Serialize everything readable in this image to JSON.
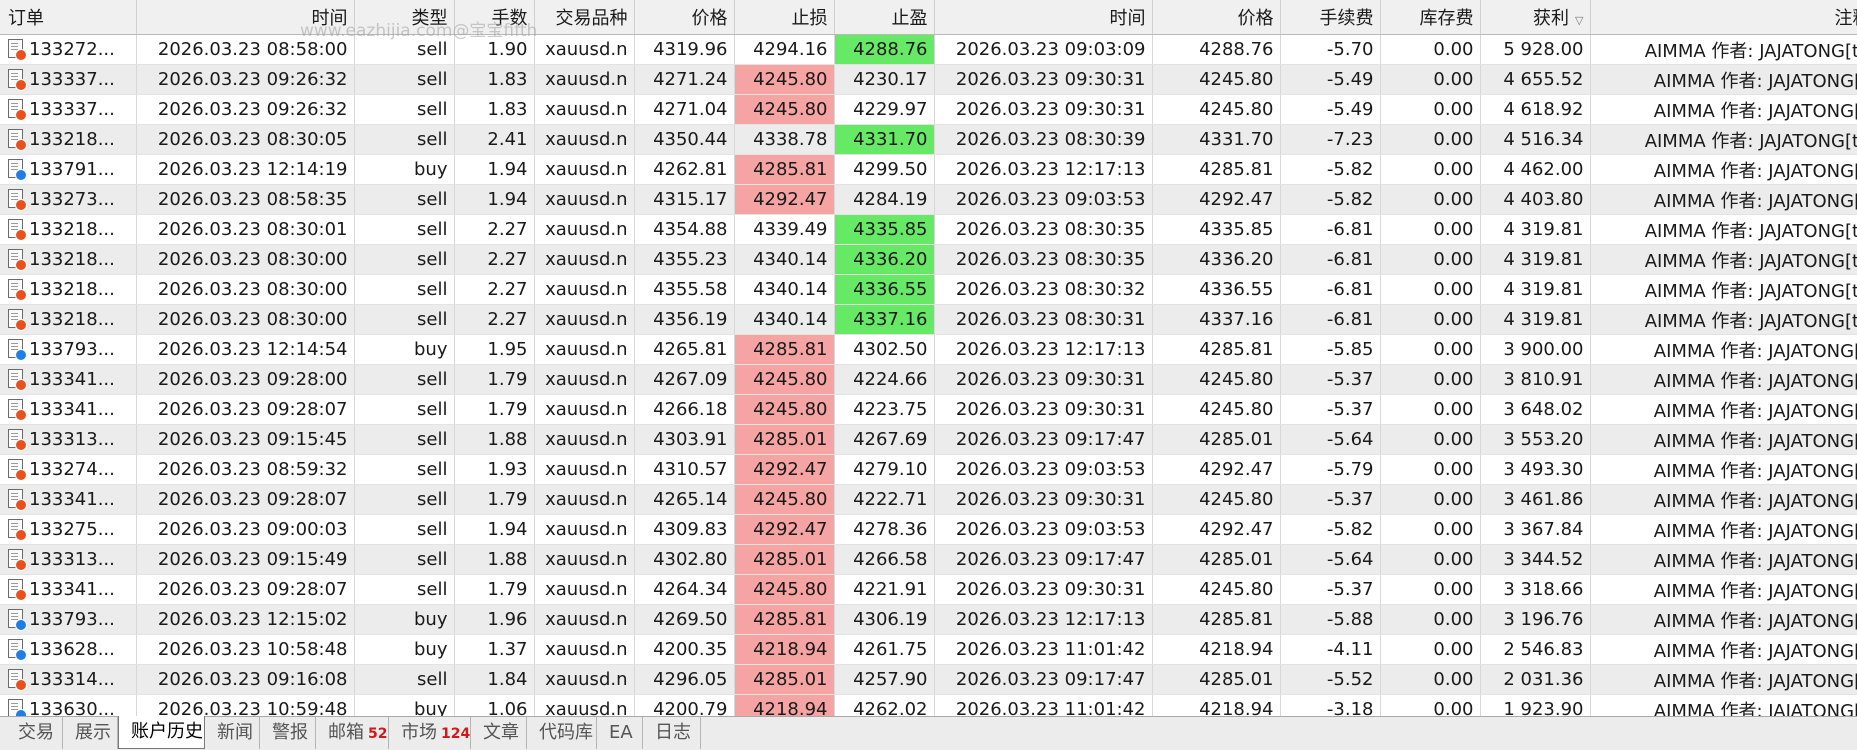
{
  "watermark": "www.eazhijia.com@宝宝fifth",
  "columns": [
    {
      "label": "订单",
      "sorted": false
    },
    {
      "label": "时间",
      "sorted": false
    },
    {
      "label": "类型",
      "sorted": false
    },
    {
      "label": "手数",
      "sorted": false
    },
    {
      "label": "交易品种",
      "sorted": false
    },
    {
      "label": "价格",
      "sorted": false
    },
    {
      "label": "止损",
      "sorted": false
    },
    {
      "label": "止盈",
      "sorted": false
    },
    {
      "label": "时间",
      "sorted": false
    },
    {
      "label": "价格",
      "sorted": false
    },
    {
      "label": "手续费",
      "sorted": false
    },
    {
      "label": "库存费",
      "sorted": false
    },
    {
      "label": "获利",
      "sorted": true
    },
    {
      "label": "注释",
      "sorted": false
    }
  ],
  "colors": {
    "sl_hit": "#f5a3a3",
    "tp_hit": "#66ea66",
    "sell_dot": "#e8501e",
    "buy_dot": "#1e7ee8"
  },
  "rows": [
    {
      "order": "133272...",
      "open_time": "2026.03.23 08:58:00",
      "type": "sell",
      "volume": "1.90",
      "symbol": "xauusd.n",
      "price": "4319.96",
      "sl": "4294.16",
      "tp": "4288.76",
      "close_time": "2026.03.23 09:03:09",
      "close_price": "4288.76",
      "commission": "-5.70",
      "swap": "0.00",
      "profit": "5 928.00",
      "comment": "AIMMA 作者: JAJATONG[tp",
      "hit": "tp"
    },
    {
      "order": "133337...",
      "open_time": "2026.03.23 09:26:32",
      "type": "sell",
      "volume": "1.83",
      "symbol": "xauusd.n",
      "price": "4271.24",
      "sl": "4245.80",
      "tp": "4230.17",
      "close_time": "2026.03.23 09:30:31",
      "close_price": "4245.80",
      "commission": "-5.49",
      "swap": "0.00",
      "profit": "4 655.52",
      "comment": "AIMMA 作者: JAJATONG[s",
      "hit": "sl"
    },
    {
      "order": "133337...",
      "open_time": "2026.03.23 09:26:32",
      "type": "sell",
      "volume": "1.83",
      "symbol": "xauusd.n",
      "price": "4271.04",
      "sl": "4245.80",
      "tp": "4229.97",
      "close_time": "2026.03.23 09:30:31",
      "close_price": "4245.80",
      "commission": "-5.49",
      "swap": "0.00",
      "profit": "4 618.92",
      "comment": "AIMMA 作者: JAJATONG[s",
      "hit": "sl"
    },
    {
      "order": "133218...",
      "open_time": "2026.03.23 08:30:05",
      "type": "sell",
      "volume": "2.41",
      "symbol": "xauusd.n",
      "price": "4350.44",
      "sl": "4338.78",
      "tp": "4331.70",
      "close_time": "2026.03.23 08:30:39",
      "close_price": "4331.70",
      "commission": "-7.23",
      "swap": "0.00",
      "profit": "4 516.34",
      "comment": "AIMMA 作者: JAJATONG[tp",
      "hit": "tp"
    },
    {
      "order": "133791...",
      "open_time": "2026.03.23 12:14:19",
      "type": "buy",
      "volume": "1.94",
      "symbol": "xauusd.n",
      "price": "4262.81",
      "sl": "4285.81",
      "tp": "4299.50",
      "close_time": "2026.03.23 12:17:13",
      "close_price": "4285.81",
      "commission": "-5.82",
      "swap": "0.00",
      "profit": "4 462.00",
      "comment": "AIMMA 作者: JAJATONG[s",
      "hit": "sl"
    },
    {
      "order": "133273...",
      "open_time": "2026.03.23 08:58:35",
      "type": "sell",
      "volume": "1.94",
      "symbol": "xauusd.n",
      "price": "4315.17",
      "sl": "4292.47",
      "tp": "4284.19",
      "close_time": "2026.03.23 09:03:53",
      "close_price": "4292.47",
      "commission": "-5.82",
      "swap": "0.00",
      "profit": "4 403.80",
      "comment": "AIMMA 作者: JAJATONG[s",
      "hit": "sl"
    },
    {
      "order": "133218...",
      "open_time": "2026.03.23 08:30:01",
      "type": "sell",
      "volume": "2.27",
      "symbol": "xauusd.n",
      "price": "4354.88",
      "sl": "4339.49",
      "tp": "4335.85",
      "close_time": "2026.03.23 08:30:35",
      "close_price": "4335.85",
      "commission": "-6.81",
      "swap": "0.00",
      "profit": "4 319.81",
      "comment": "AIMMA 作者: JAJATONG[tp",
      "hit": "tp"
    },
    {
      "order": "133218...",
      "open_time": "2026.03.23 08:30:00",
      "type": "sell",
      "volume": "2.27",
      "symbol": "xauusd.n",
      "price": "4355.23",
      "sl": "4340.14",
      "tp": "4336.20",
      "close_time": "2026.03.23 08:30:35",
      "close_price": "4336.20",
      "commission": "-6.81",
      "swap": "0.00",
      "profit": "4 319.81",
      "comment": "AIMMA 作者: JAJATONG[tp",
      "hit": "tp"
    },
    {
      "order": "133218...",
      "open_time": "2026.03.23 08:30:00",
      "type": "sell",
      "volume": "2.27",
      "symbol": "xauusd.n",
      "price": "4355.58",
      "sl": "4340.14",
      "tp": "4336.55",
      "close_time": "2026.03.23 08:30:32",
      "close_price": "4336.55",
      "commission": "-6.81",
      "swap": "0.00",
      "profit": "4 319.81",
      "comment": "AIMMA 作者: JAJATONG[tp",
      "hit": "tp"
    },
    {
      "order": "133218...",
      "open_time": "2026.03.23 08:30:00",
      "type": "sell",
      "volume": "2.27",
      "symbol": "xauusd.n",
      "price": "4356.19",
      "sl": "4340.14",
      "tp": "4337.16",
      "close_time": "2026.03.23 08:30:31",
      "close_price": "4337.16",
      "commission": "-6.81",
      "swap": "0.00",
      "profit": "4 319.81",
      "comment": "AIMMA 作者: JAJATONG[tp",
      "hit": "tp"
    },
    {
      "order": "133793...",
      "open_time": "2026.03.23 12:14:54",
      "type": "buy",
      "volume": "1.95",
      "symbol": "xauusd.n",
      "price": "4265.81",
      "sl": "4285.81",
      "tp": "4302.50",
      "close_time": "2026.03.23 12:17:13",
      "close_price": "4285.81",
      "commission": "-5.85",
      "swap": "0.00",
      "profit": "3 900.00",
      "comment": "AIMMA 作者: JAJATONG[s",
      "hit": "sl"
    },
    {
      "order": "133341...",
      "open_time": "2026.03.23 09:28:00",
      "type": "sell",
      "volume": "1.79",
      "symbol": "xauusd.n",
      "price": "4267.09",
      "sl": "4245.80",
      "tp": "4224.66",
      "close_time": "2026.03.23 09:30:31",
      "close_price": "4245.80",
      "commission": "-5.37",
      "swap": "0.00",
      "profit": "3 810.91",
      "comment": "AIMMA 作者: JAJATONG[s",
      "hit": "sl"
    },
    {
      "order": "133341...",
      "open_time": "2026.03.23 09:28:07",
      "type": "sell",
      "volume": "1.79",
      "symbol": "xauusd.n",
      "price": "4266.18",
      "sl": "4245.80",
      "tp": "4223.75",
      "close_time": "2026.03.23 09:30:31",
      "close_price": "4245.80",
      "commission": "-5.37",
      "swap": "0.00",
      "profit": "3 648.02",
      "comment": "AIMMA 作者: JAJATONG[s",
      "hit": "sl"
    },
    {
      "order": "133313...",
      "open_time": "2026.03.23 09:15:45",
      "type": "sell",
      "volume": "1.88",
      "symbol": "xauusd.n",
      "price": "4303.91",
      "sl": "4285.01",
      "tp": "4267.69",
      "close_time": "2026.03.23 09:17:47",
      "close_price": "4285.01",
      "commission": "-5.64",
      "swap": "0.00",
      "profit": "3 553.20",
      "comment": "AIMMA 作者: JAJATONG[s",
      "hit": "sl"
    },
    {
      "order": "133274...",
      "open_time": "2026.03.23 08:59:32",
      "type": "sell",
      "volume": "1.93",
      "symbol": "xauusd.n",
      "price": "4310.57",
      "sl": "4292.47",
      "tp": "4279.10",
      "close_time": "2026.03.23 09:03:53",
      "close_price": "4292.47",
      "commission": "-5.79",
      "swap": "0.00",
      "profit": "3 493.30",
      "comment": "AIMMA 作者: JAJATONG[s",
      "hit": "sl"
    },
    {
      "order": "133341...",
      "open_time": "2026.03.23 09:28:07",
      "type": "sell",
      "volume": "1.79",
      "symbol": "xauusd.n",
      "price": "4265.14",
      "sl": "4245.80",
      "tp": "4222.71",
      "close_time": "2026.03.23 09:30:31",
      "close_price": "4245.80",
      "commission": "-5.37",
      "swap": "0.00",
      "profit": "3 461.86",
      "comment": "AIMMA 作者: JAJATONG[s",
      "hit": "sl"
    },
    {
      "order": "133275...",
      "open_time": "2026.03.23 09:00:03",
      "type": "sell",
      "volume": "1.94",
      "symbol": "xauusd.n",
      "price": "4309.83",
      "sl": "4292.47",
      "tp": "4278.36",
      "close_time": "2026.03.23 09:03:53",
      "close_price": "4292.47",
      "commission": "-5.82",
      "swap": "0.00",
      "profit": "3 367.84",
      "comment": "AIMMA 作者: JAJATONG[s",
      "hit": "sl"
    },
    {
      "order": "133313...",
      "open_time": "2026.03.23 09:15:49",
      "type": "sell",
      "volume": "1.88",
      "symbol": "xauusd.n",
      "price": "4302.80",
      "sl": "4285.01",
      "tp": "4266.58",
      "close_time": "2026.03.23 09:17:47",
      "close_price": "4285.01",
      "commission": "-5.64",
      "swap": "0.00",
      "profit": "3 344.52",
      "comment": "AIMMA 作者: JAJATONG[s",
      "hit": "sl"
    },
    {
      "order": "133341...",
      "open_time": "2026.03.23 09:28:07",
      "type": "sell",
      "volume": "1.79",
      "symbol": "xauusd.n",
      "price": "4264.34",
      "sl": "4245.80",
      "tp": "4221.91",
      "close_time": "2026.03.23 09:30:31",
      "close_price": "4245.80",
      "commission": "-5.37",
      "swap": "0.00",
      "profit": "3 318.66",
      "comment": "AIMMA 作者: JAJATONG[s",
      "hit": "sl"
    },
    {
      "order": "133793...",
      "open_time": "2026.03.23 12:15:02",
      "type": "buy",
      "volume": "1.96",
      "symbol": "xauusd.n",
      "price": "4269.50",
      "sl": "4285.81",
      "tp": "4306.19",
      "close_time": "2026.03.23 12:17:13",
      "close_price": "4285.81",
      "commission": "-5.88",
      "swap": "0.00",
      "profit": "3 196.76",
      "comment": "AIMMA 作者: JAJATONG[s",
      "hit": "sl"
    },
    {
      "order": "133628...",
      "open_time": "2026.03.23 10:58:48",
      "type": "buy",
      "volume": "1.37",
      "symbol": "xauusd.n",
      "price": "4200.35",
      "sl": "4218.94",
      "tp": "4261.75",
      "close_time": "2026.03.23 11:01:42",
      "close_price": "4218.94",
      "commission": "-4.11",
      "swap": "0.00",
      "profit": "2 546.83",
      "comment": "AIMMA 作者: JAJATONG[s",
      "hit": "sl"
    },
    {
      "order": "133314...",
      "open_time": "2026.03.23 09:16:08",
      "type": "sell",
      "volume": "1.84",
      "symbol": "xauusd.n",
      "price": "4296.05",
      "sl": "4285.01",
      "tp": "4257.90",
      "close_time": "2026.03.23 09:17:47",
      "close_price": "4285.01",
      "commission": "-5.52",
      "swap": "0.00",
      "profit": "2 031.36",
      "comment": "AIMMA 作者: JAJATONG[s",
      "hit": "sl"
    },
    {
      "order": "133630...",
      "open_time": "2026.03.23 10:59:48",
      "type": "buy",
      "volume": "1.06",
      "symbol": "xauusd.n",
      "price": "4200.79",
      "sl": "4218.94",
      "tp": "4262.02",
      "close_time": "2026.03.23 11:01:42",
      "close_price": "4218.94",
      "commission": "-3.18",
      "swap": "0.00",
      "profit": "1 923.90",
      "comment": "AIMMA 作者: JAJATONG[s",
      "hit": "sl"
    }
  ],
  "tabs": [
    {
      "label": "交易",
      "badge": "",
      "active": false
    },
    {
      "label": "展示",
      "badge": "",
      "active": false
    },
    {
      "label": "账户历史",
      "badge": "",
      "active": true
    },
    {
      "label": "新闻",
      "badge": "",
      "active": false
    },
    {
      "label": "警报",
      "badge": "",
      "active": false
    },
    {
      "label": "邮箱",
      "badge": "52",
      "active": false
    },
    {
      "label": "市场",
      "badge": "124",
      "active": false
    },
    {
      "label": "文章",
      "badge": "",
      "active": false
    },
    {
      "label": "代码库",
      "badge": "",
      "active": false
    },
    {
      "label": "EA",
      "badge": "",
      "active": false
    },
    {
      "label": "日志",
      "badge": "",
      "active": false
    }
  ]
}
